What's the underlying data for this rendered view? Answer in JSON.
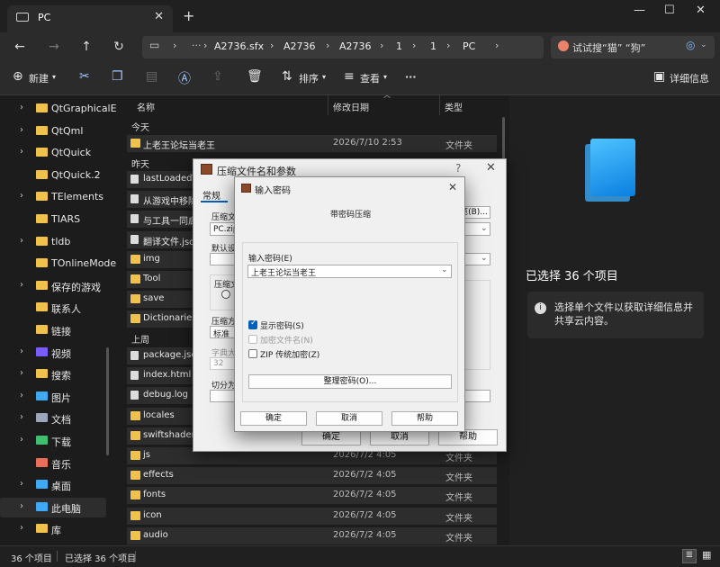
{
  "tab": {
    "title": "PC"
  },
  "address": {
    "crumbs": [
      "A2736.sfx",
      "A2736",
      "A2736",
      "1",
      "1",
      "PC"
    ]
  },
  "search": {
    "placeholder": "试试搜“猫” “狗”"
  },
  "toolbar": {
    "new": "新建",
    "sort": "排序",
    "view": "查看",
    "more": "···",
    "details": "详细信息"
  },
  "leftnav": [
    {
      "label": "QtGraphicalE",
      "chev": true
    },
    {
      "label": "QtQml",
      "chev": true
    },
    {
      "label": "QtQuick",
      "chev": true
    },
    {
      "label": "QtQuick.2",
      "chev": false
    },
    {
      "label": "TElements",
      "chev": true
    },
    {
      "label": "TIARS",
      "chev": false
    },
    {
      "label": "tldb",
      "chev": true
    },
    {
      "label": "TOnlineMode",
      "chev": false
    },
    {
      "label": "保存的游戏",
      "chev": true
    },
    {
      "label": "联系人",
      "chev": false
    },
    {
      "label": "链接",
      "chev": false
    },
    {
      "label": "视频",
      "chev": true
    },
    {
      "label": "搜索",
      "chev": true
    },
    {
      "label": "图片",
      "chev": true
    },
    {
      "label": "文档",
      "chev": true
    },
    {
      "label": "下载",
      "chev": true
    },
    {
      "label": "音乐",
      "chev": false
    },
    {
      "label": "桌面",
      "chev": true
    },
    {
      "label": "此电脑",
      "chev": true
    },
    {
      "label": "库",
      "chev": true
    }
  ],
  "columns": {
    "name": "名称",
    "date": "修改日期",
    "type": "类型"
  },
  "groups": {
    "today": "今天",
    "yesterday": "昨天",
    "lastweek": "上周"
  },
  "files": {
    "today": [
      {
        "name": "上老王论坛当老王",
        "date": "2026/7/10 2:53",
        "type": "文件夹"
      }
    ],
    "yesterday": [
      {
        "name": "lastLoadedT",
        "date": "",
        "type": ""
      },
      {
        "name": "从游戏中移除",
        "date": "",
        "type": ""
      },
      {
        "name": "与工具一同启",
        "date": "",
        "type": ""
      },
      {
        "name": "翻译文件.json",
        "date": "",
        "type": ""
      },
      {
        "name": "img",
        "date": "",
        "type": ""
      },
      {
        "name": "Tool",
        "date": "",
        "type": ""
      },
      {
        "name": "save",
        "date": "",
        "type": ""
      },
      {
        "name": "Dictionaries",
        "date": "",
        "type": ""
      }
    ],
    "lastweek": [
      {
        "name": "package.json",
        "date": "",
        "type": ""
      },
      {
        "name": "index.html",
        "date": "",
        "type": ""
      },
      {
        "name": "debug.log",
        "date": "",
        "type": ""
      },
      {
        "name": "locales",
        "date": "",
        "type": ""
      },
      {
        "name": "swiftshader",
        "date": "",
        "type": ""
      },
      {
        "name": "js",
        "date": "2026/7/2 4:05",
        "type": "文件夹"
      },
      {
        "name": "effects",
        "date": "2026/7/2 4:05",
        "type": "文件夹"
      },
      {
        "name": "fonts",
        "date": "2026/7/2 4:05",
        "type": "文件夹"
      },
      {
        "name": "icon",
        "date": "2026/7/2 4:05",
        "type": "文件夹"
      },
      {
        "name": "audio",
        "date": "2026/7/2 4:05",
        "type": "文件夹"
      }
    ]
  },
  "details": {
    "selected": "已选择 36 个项目",
    "info": "选择单个文件以获取详细信息并共享云内容。"
  },
  "status": {
    "count": "36 个项目",
    "selected": "已选择 36 个项目"
  },
  "dialog1": {
    "title": "压缩文件名和参数",
    "tab_general": "常规",
    "archive_label": "压缩文件名",
    "archive_value": "PC.zip",
    "browse": "浏览(B)...",
    "default_label": "默认设置",
    "format_label": "压缩文件格式",
    "method_label": "压缩方式",
    "method_value": "标准",
    "dict_label": "字典大小",
    "dict_value": "32",
    "split_label": "切分为分卷",
    "ok": "确定",
    "cancel": "取消",
    "help": "帮助"
  },
  "dialog2": {
    "title": "输入密码",
    "heading": "带密码压缩",
    "pwd_label": "输入密码(E)",
    "pwd_value": "上老王论坛当老王",
    "show_pwd": "显示密码(S)",
    "encrypt_names": "加密文件名(N)",
    "zip_legacy": "ZIP 传统加密(Z)",
    "organize": "整理密码(O)...",
    "ok": "确定",
    "cancel": "取消",
    "help": "帮助"
  }
}
